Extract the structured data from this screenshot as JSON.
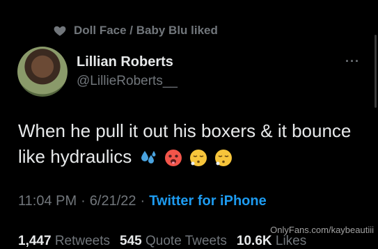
{
  "context": {
    "liked_text": "Doll Face / Baby Blu liked"
  },
  "author": {
    "name": "Lillian Roberts",
    "handle": "@LillieRoberts__"
  },
  "tweet": {
    "text": "When he pull it out his boxers & it bounce like hydraulics",
    "time": "11:04 PM",
    "date": "6/21/22",
    "separator": "·",
    "source": "Twitter for iPhone"
  },
  "stats": {
    "retweets_count": "1,447",
    "retweets_label": "Retweets",
    "quotes_count": "545",
    "quotes_label": "Quote Tweets",
    "likes_count": "10.6K",
    "likes_label": "Likes"
  },
  "watermark": "OnlyFans.com/kaybeautiii",
  "icons": [
    "heart-icon",
    "more-icon",
    "sweat-droplets-emoji",
    "hot-face-emoji",
    "face-exhaling-emoji"
  ]
}
